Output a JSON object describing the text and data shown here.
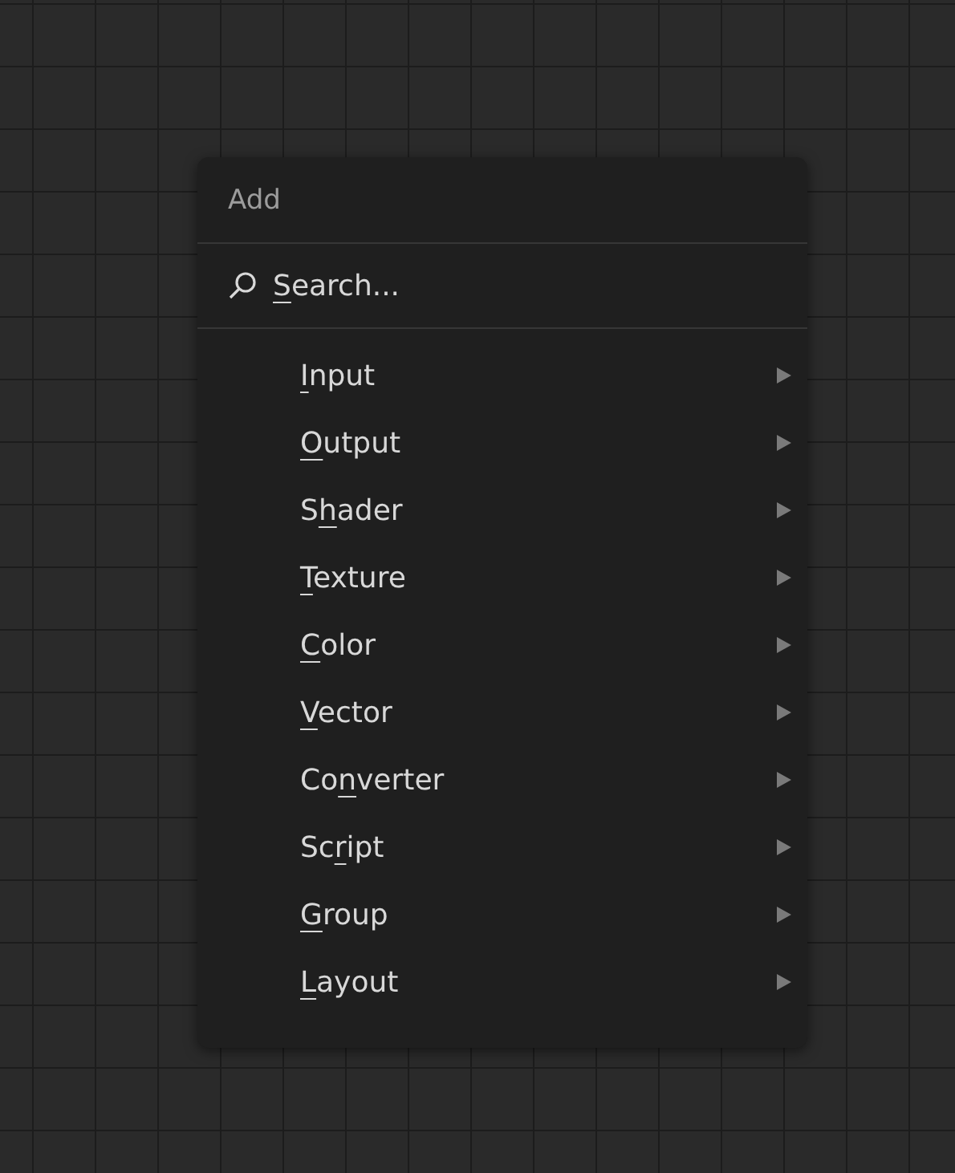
{
  "menu": {
    "title": "Add",
    "search": {
      "key": "S",
      "post": "earch..."
    },
    "items": [
      {
        "key": "I",
        "post": "nput"
      },
      {
        "key": "O",
        "post": "utput"
      },
      {
        "pre": "S",
        "key": "h",
        "post": "ader"
      },
      {
        "key": "T",
        "post": "exture"
      },
      {
        "key": "C",
        "post": "olor"
      },
      {
        "key": "V",
        "post": "ector"
      },
      {
        "pre": "Co",
        "key": "n",
        "post": "verter"
      },
      {
        "pre": "Sc",
        "key": "r",
        "post": "ipt"
      },
      {
        "key": "G",
        "post": "roup"
      },
      {
        "key": "L",
        "post": "ayout"
      }
    ]
  }
}
